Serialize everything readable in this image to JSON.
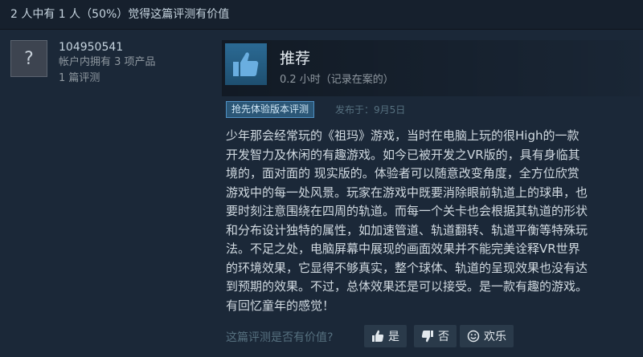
{
  "summary": "2 人中有 1 人（50%）觉得这篇评测有价值",
  "author": {
    "name": "104950541",
    "products": "帐户内拥有 3 项产品",
    "reviews": "1 篇评测",
    "avatar_glyph": "?"
  },
  "review": {
    "recommendation": "推荐",
    "hours": "0.2 小时（记录在案的）",
    "early_access_badge": "抢先体验版本评测",
    "posted": "发布于：9月5日",
    "body": "少年那会经常玩的《祖玛》游戏，当时在电脑上玩的很High的一款\n开发智力及休闲的有趣游戏。如今已被开发之VR版的，具有身临其\n境的，面对面的 现实版的。体验者可以随意改变角度，全方位欣赏\n游戏中的每一处风景。玩家在游戏中既要消除眼前轨道上的球串，也\n要时刻注意围绕在四周的轨道。而每一个关卡也会根据其轨道的形状\n和分布设计独特的属性，如加速管道、轨道翻转、轨道平衡等特殊玩\n法。不足之处，电脑屏幕中展现的画面效果并不能完美诠释VR世界\n的环境效果，它显得不够真实，整个球体、轨道的呈现效果也没有达\n到预期的效果。不过，总体效果还是可以接受。是一款有趣的游戏。\n有回忆童年的感觉！"
  },
  "helpful": {
    "question": "这篇评测是否有价值?",
    "yes": "是",
    "no": "否",
    "funny": "欢乐"
  },
  "colors": {
    "background": "#1b2838",
    "accent": "#4f90c4",
    "thumb": "#6aaee0"
  }
}
